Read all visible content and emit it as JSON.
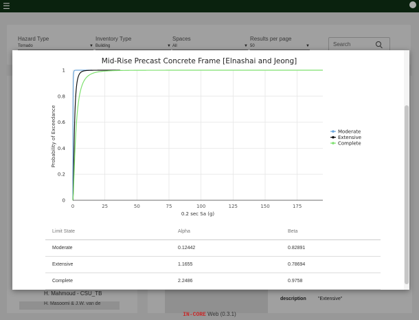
{
  "topbar": {
    "menu_icon": "hamburger-menu-icon",
    "account_icon": "account-circle-icon"
  },
  "filters": [
    {
      "label": "Hazard Type",
      "value": "Tornado"
    },
    {
      "label": "Inventory Type",
      "value": "Building"
    },
    {
      "label": "Spaces",
      "value": "All"
    },
    {
      "label": "Results per page",
      "value": "50"
    }
  ],
  "search": {
    "placeholder": "Search"
  },
  "background": {
    "author": "H. Mahmoud - CSU_TB",
    "author2": "H. Masoomi & J.W. van de",
    "description_label": "description",
    "description_value": "\"Extensive\""
  },
  "footer": {
    "brand": "IN-CORE",
    "text": " Web (0.3.1)"
  },
  "chart_data": {
    "type": "line",
    "title": "Mid-Rise Precast Concrete Frame [Elnashai and Jeong]",
    "xlabel": "0.2 sec Sa (g)",
    "ylabel": "Probability of Exceedance",
    "xlim": [
      0,
      195
    ],
    "ylim": [
      0,
      1
    ],
    "xticks": [
      0,
      25,
      50,
      75,
      100,
      125,
      150,
      175
    ],
    "yticks": [
      0,
      0.2,
      0.4,
      0.6,
      0.8,
      1
    ],
    "grid": true,
    "legend_position": "right",
    "series": [
      {
        "name": "Moderate",
        "color": "#6aa3d9",
        "alpha": 0.12442,
        "beta": 0.82891,
        "x_max": 15
      },
      {
        "name": "Extensive",
        "color": "#111111",
        "alpha": 1.1655,
        "beta": 0.78694,
        "x_max": 37
      },
      {
        "name": "Complete",
        "color": "#7de06e",
        "alpha": 2.2486,
        "beta": 0.9758,
        "x_max": 195
      }
    ]
  },
  "table": {
    "headers": [
      "Limit State",
      "Alpha",
      "Beta"
    ],
    "rows": [
      [
        "Moderate",
        "0.12442",
        "0.82891"
      ],
      [
        "Extensive",
        "1.1655",
        "0.78694"
      ],
      [
        "Complete",
        "2.2486",
        "0.9758"
      ]
    ]
  }
}
